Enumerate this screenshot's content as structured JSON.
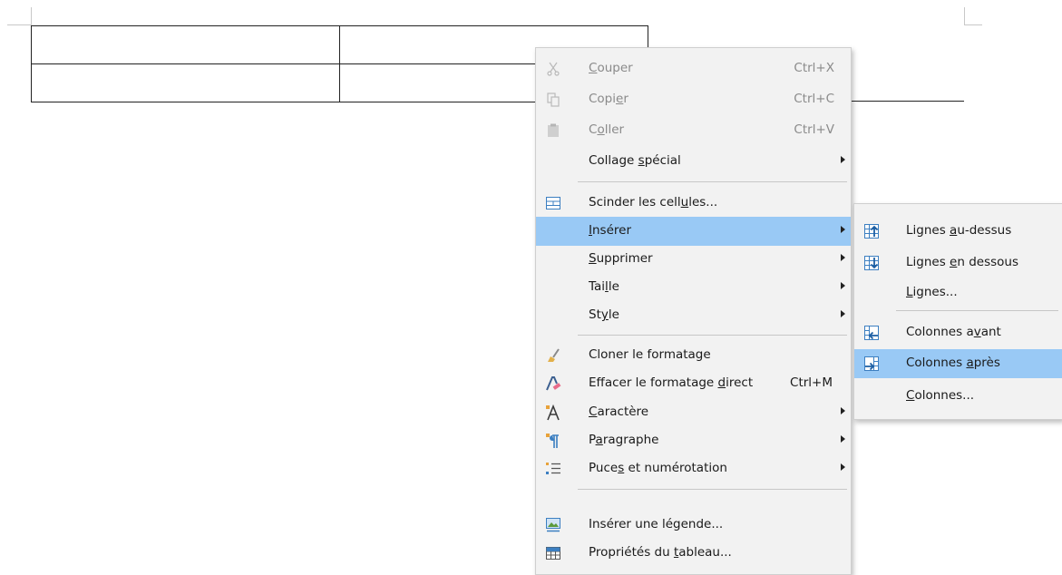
{
  "main_menu": {
    "items": [
      {
        "pre": "",
        "u": "C",
        "post": "ouper",
        "accel": "Ctrl+X",
        "icon": "cut-icon",
        "disabled": true
      },
      {
        "pre": "Copi",
        "u": "e",
        "post": "r",
        "accel": "Ctrl+C",
        "icon": "copy-icon",
        "disabled": true
      },
      {
        "pre": "C",
        "u": "o",
        "post": "ller",
        "accel": "Ctrl+V",
        "icon": "paste-icon",
        "disabled": true
      },
      {
        "pre": "Collage ",
        "u": "s",
        "post": "pécial",
        "accel": "",
        "icon": "",
        "submenu": true
      },
      {
        "pre": "Scinder les cell",
        "u": "u",
        "post": "les...",
        "accel": "",
        "icon": "split-cells-icon"
      },
      {
        "pre": "",
        "u": "I",
        "post": "nsérer",
        "accel": "",
        "icon": "",
        "submenu": true,
        "highlight": true
      },
      {
        "pre": "",
        "u": "S",
        "post": "upprimer",
        "accel": "",
        "icon": "",
        "submenu": true
      },
      {
        "pre": "Tai",
        "u": "l",
        "post": "le",
        "accel": "",
        "icon": "",
        "submenu": true
      },
      {
        "pre": "St",
        "u": "y",
        "post": "le",
        "accel": "",
        "icon": "",
        "submenu": true
      },
      {
        "pre": "Cloner le formatage",
        "u": "",
        "post": "",
        "accel": "",
        "icon": "clone-formatting-icon"
      },
      {
        "pre": "Effacer le formatage ",
        "u": "d",
        "post": "irect",
        "accel": "Ctrl+M",
        "icon": "clear-formatting-icon"
      },
      {
        "pre": "",
        "u": "C",
        "post": "aractère",
        "accel": "",
        "icon": "character-icon",
        "submenu": true
      },
      {
        "pre": "P",
        "u": "a",
        "post": "ragraphe",
        "accel": "",
        "icon": "paragraph-icon",
        "submenu": true
      },
      {
        "pre": "Puce",
        "u": "s",
        "post": " et numérotation",
        "accel": "",
        "icon": "bullets-numbering-icon",
        "submenu": true
      },
      {
        "pre": "Insérer une légende...",
        "u": "",
        "post": "",
        "accel": "",
        "icon": "insert-caption-icon"
      },
      {
        "pre": "Propriétés du ",
        "u": "t",
        "post": "ableau...",
        "accel": "",
        "icon": "table-properties-icon"
      }
    ]
  },
  "sub_menu": {
    "items": [
      {
        "pre": "Lignes ",
        "u": "a",
        "post": "u-dessus",
        "icon": "insert-rows-above-icon"
      },
      {
        "pre": "Lignes ",
        "u": "e",
        "post": "n dessous",
        "icon": "insert-rows-below-icon"
      },
      {
        "pre": "",
        "u": "L",
        "post": "ignes...",
        "icon": ""
      },
      {
        "pre": "Colonnes a",
        "u": "v",
        "post": "ant",
        "icon": "insert-columns-before-icon"
      },
      {
        "pre": "Colonnes ",
        "u": "a",
        "post": "près",
        "icon": "insert-columns-after-icon",
        "highlight": true
      },
      {
        "pre": "",
        "u": "C",
        "post": "olonnes...",
        "icon": ""
      }
    ]
  },
  "colors": {
    "highlight": "#99c9f5",
    "menu_bg": "#f2f2f2",
    "icon_blue": "#3c7fc1"
  }
}
